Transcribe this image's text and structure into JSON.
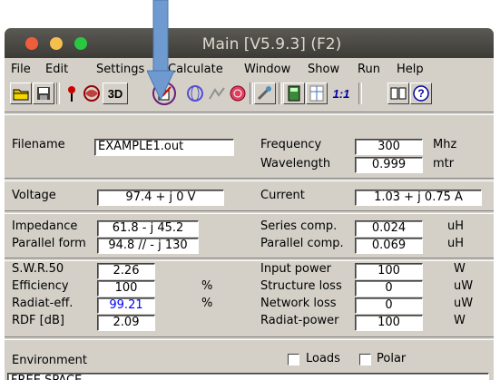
{
  "window": {
    "title": "Main [V5.9.3]  (F2)"
  },
  "menu": [
    {
      "label": "File"
    },
    {
      "label": "Edit"
    },
    {
      "label": "Settings"
    },
    {
      "label": "Calculate"
    },
    {
      "label": "Window"
    },
    {
      "label": "Show"
    },
    {
      "label": "Run"
    },
    {
      "label": "Help"
    }
  ],
  "toolbar": {
    "btn_3d": "3D",
    "btn_one_to_one": "1:1"
  },
  "fields": {
    "filename": {
      "label": "Filename",
      "value": "EXAMPLE1.out"
    },
    "frequency": {
      "label": "Frequency",
      "value": "300",
      "unit": "Mhz"
    },
    "wavelength": {
      "label": "Wavelength",
      "value": "0.999",
      "unit": "mtr"
    },
    "voltage": {
      "label": "Voltage",
      "value": "97.4 + j 0 V"
    },
    "current": {
      "label": "Current",
      "value": "1.03 + j 0.75 A"
    },
    "impedance": {
      "label": "Impedance",
      "value": "61.8 - j 45.2"
    },
    "parallel_form": {
      "label": "Parallel form",
      "value": "94.8 // - j 130"
    },
    "series_comp": {
      "label": "Series comp.",
      "value": "0.024",
      "unit": "uH"
    },
    "parallel_comp": {
      "label": "Parallel comp.",
      "value": "0.069",
      "unit": "uH"
    },
    "swr": {
      "label": "S.W.R.50",
      "value": "2.26"
    },
    "efficiency": {
      "label": "Efficiency",
      "value": "100",
      "unit": "%"
    },
    "radiat_eff": {
      "label": "Radiat-eff.",
      "value": "99.21",
      "unit": "%"
    },
    "rdf": {
      "label": "RDF [dB]",
      "value": "2.09"
    },
    "input_power": {
      "label": "Input power",
      "value": "100",
      "unit": "W"
    },
    "structure_loss": {
      "label": "Structure loss",
      "value": "0",
      "unit": "uW"
    },
    "network_loss": {
      "label": "Network loss",
      "value": "0",
      "unit": "uW"
    },
    "radiat_power": {
      "label": "Radiat-power",
      "value": "100",
      "unit": "W"
    },
    "environment": {
      "label": "Environment",
      "value": "FREE SPACE"
    }
  },
  "checkboxes": {
    "loads": {
      "label": "Loads",
      "checked": false
    },
    "polar": {
      "label": "Polar",
      "checked": false
    }
  },
  "colors": {
    "title_bar": "#3c3b37",
    "window_bg": "#d4d0c8",
    "arrow": "#6f9ad0",
    "highlight_ring": "#6a1f78",
    "radiat_eff_text": "#0000ff"
  }
}
